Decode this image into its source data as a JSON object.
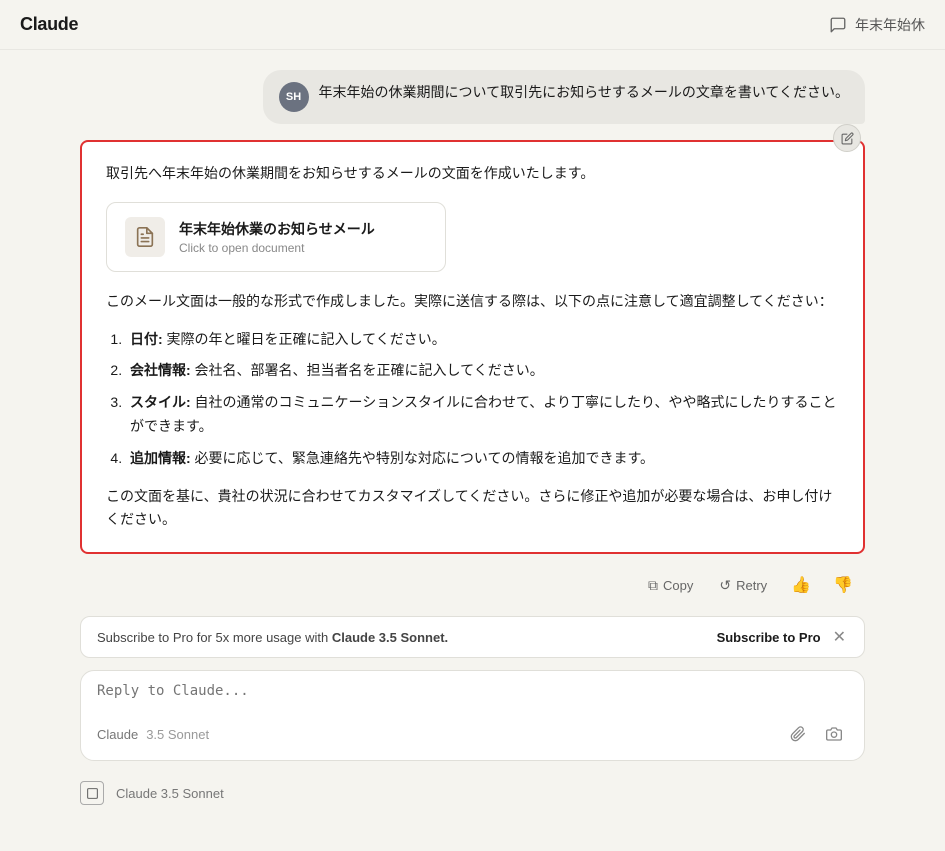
{
  "header": {
    "logo": "Claude",
    "conversation_title": "年末年始休",
    "chat_icon_label": "chat-icon"
  },
  "user_message": {
    "avatar_initials": "SH",
    "text": "年末年始の休業期間について取引先にお知らせするメールの文章を書いてください。"
  },
  "assistant_message": {
    "intro": "取引先へ年末年始の休業期間をお知らせするメールの文面を作成いたします。",
    "doc_card": {
      "title": "年末年始休業のお知らせメール",
      "subtitle": "Click to open document"
    },
    "body": "このメール文面は一般的な形式で作成しました。実際に送信する際は、以下の点に注意して適宜調整してください：",
    "list": [
      {
        "label": "日付",
        "text": "実際の年と曜日を正確に記入してください。"
      },
      {
        "label": "会社情報",
        "text": "会社名、部署名、担当者名を正確に記入してください。"
      },
      {
        "label": "スタイル",
        "text": "自社の通常のコミュニケーションスタイルに合わせて、より丁寧にしたり、やや略式にしたりすることができます。"
      },
      {
        "label": "追加情報",
        "text": "必要に応じて、緊急連絡先や特別な対応についての情報を追加できます。"
      }
    ],
    "closing": "この文面を基に、貴社の状況に合わせてカスタマイズしてください。さらに修正や追加が必要な場合は、お申し付けください。"
  },
  "action_bar": {
    "copy_label": "Copy",
    "retry_label": "Retry"
  },
  "subscribe_banner": {
    "text": "Subscribe to Pro for 5x more usage with ",
    "highlight": "Claude 3.5 Sonnet.",
    "cta": "Subscribe to Pro"
  },
  "input": {
    "placeholder": "Reply to Claude...",
    "model_label": "Claude",
    "model_version": "3.5 Sonnet"
  }
}
